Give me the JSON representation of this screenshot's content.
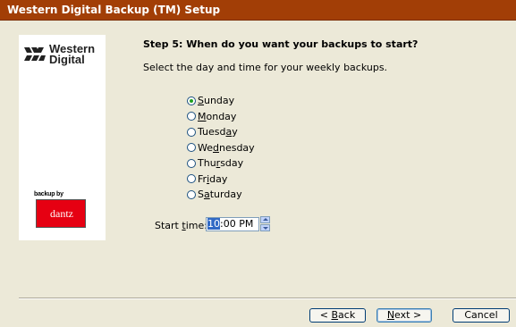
{
  "window": {
    "title": "Western Digital Backup (TM) Setup"
  },
  "sidebar": {
    "brand_line1": "Western",
    "brand_line2": "Digital",
    "partner_caption": "backup by",
    "partner_name": "dantz"
  },
  "step": {
    "title": "Step 5: When do you want your backups to start?",
    "description": "Select the day and time for your weekly backups."
  },
  "days": [
    {
      "label": "Sunday",
      "checked": true
    },
    {
      "label": "Monday",
      "checked": false
    },
    {
      "label": "Tuesday",
      "checked": false
    },
    {
      "label": "Wednesday",
      "checked": false
    },
    {
      "label": "Thursday",
      "checked": false
    },
    {
      "label": "Friday",
      "checked": false
    },
    {
      "label": "Saturday",
      "checked": false
    }
  ],
  "start_time": {
    "label": "Start time:",
    "hour": "10",
    "rest": ":00 PM"
  },
  "buttons": {
    "back": "< Back",
    "next": "Next >",
    "cancel": "Cancel"
  },
  "colors": {
    "titlebar": "#a23e06",
    "radio_check": "#21a121",
    "selection": "#316ac5"
  }
}
